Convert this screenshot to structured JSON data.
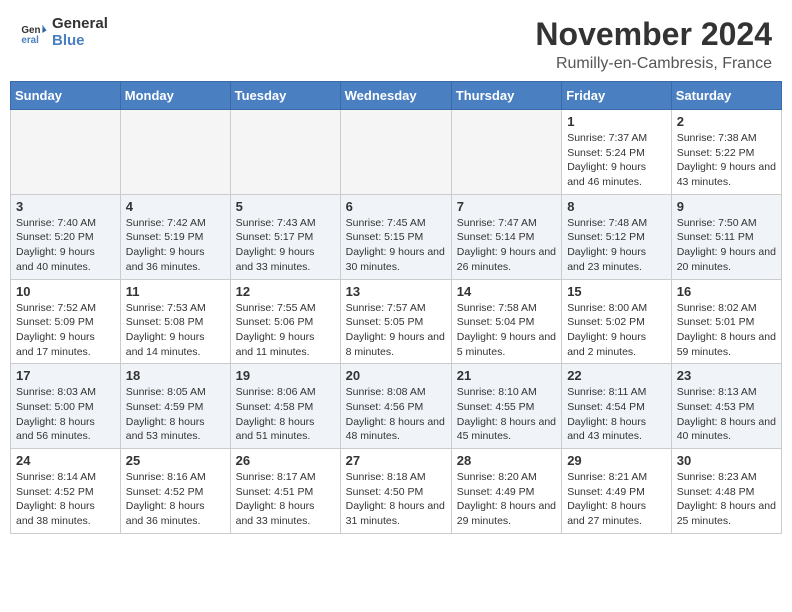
{
  "header": {
    "logo_line1": "General",
    "logo_line2": "Blue",
    "month": "November 2024",
    "location": "Rumilly-en-Cambresis, France"
  },
  "days_of_week": [
    "Sunday",
    "Monday",
    "Tuesday",
    "Wednesday",
    "Thursday",
    "Friday",
    "Saturday"
  ],
  "weeks": [
    [
      {
        "day": "",
        "info": ""
      },
      {
        "day": "",
        "info": ""
      },
      {
        "day": "",
        "info": ""
      },
      {
        "day": "",
        "info": ""
      },
      {
        "day": "",
        "info": ""
      },
      {
        "day": "1",
        "info": "Sunrise: 7:37 AM\nSunset: 5:24 PM\nDaylight: 9 hours and 46 minutes."
      },
      {
        "day": "2",
        "info": "Sunrise: 7:38 AM\nSunset: 5:22 PM\nDaylight: 9 hours and 43 minutes."
      }
    ],
    [
      {
        "day": "3",
        "info": "Sunrise: 7:40 AM\nSunset: 5:20 PM\nDaylight: 9 hours and 40 minutes."
      },
      {
        "day": "4",
        "info": "Sunrise: 7:42 AM\nSunset: 5:19 PM\nDaylight: 9 hours and 36 minutes."
      },
      {
        "day": "5",
        "info": "Sunrise: 7:43 AM\nSunset: 5:17 PM\nDaylight: 9 hours and 33 minutes."
      },
      {
        "day": "6",
        "info": "Sunrise: 7:45 AM\nSunset: 5:15 PM\nDaylight: 9 hours and 30 minutes."
      },
      {
        "day": "7",
        "info": "Sunrise: 7:47 AM\nSunset: 5:14 PM\nDaylight: 9 hours and 26 minutes."
      },
      {
        "day": "8",
        "info": "Sunrise: 7:48 AM\nSunset: 5:12 PM\nDaylight: 9 hours and 23 minutes."
      },
      {
        "day": "9",
        "info": "Sunrise: 7:50 AM\nSunset: 5:11 PM\nDaylight: 9 hours and 20 minutes."
      }
    ],
    [
      {
        "day": "10",
        "info": "Sunrise: 7:52 AM\nSunset: 5:09 PM\nDaylight: 9 hours and 17 minutes."
      },
      {
        "day": "11",
        "info": "Sunrise: 7:53 AM\nSunset: 5:08 PM\nDaylight: 9 hours and 14 minutes."
      },
      {
        "day": "12",
        "info": "Sunrise: 7:55 AM\nSunset: 5:06 PM\nDaylight: 9 hours and 11 minutes."
      },
      {
        "day": "13",
        "info": "Sunrise: 7:57 AM\nSunset: 5:05 PM\nDaylight: 9 hours and 8 minutes."
      },
      {
        "day": "14",
        "info": "Sunrise: 7:58 AM\nSunset: 5:04 PM\nDaylight: 9 hours and 5 minutes."
      },
      {
        "day": "15",
        "info": "Sunrise: 8:00 AM\nSunset: 5:02 PM\nDaylight: 9 hours and 2 minutes."
      },
      {
        "day": "16",
        "info": "Sunrise: 8:02 AM\nSunset: 5:01 PM\nDaylight: 8 hours and 59 minutes."
      }
    ],
    [
      {
        "day": "17",
        "info": "Sunrise: 8:03 AM\nSunset: 5:00 PM\nDaylight: 8 hours and 56 minutes."
      },
      {
        "day": "18",
        "info": "Sunrise: 8:05 AM\nSunset: 4:59 PM\nDaylight: 8 hours and 53 minutes."
      },
      {
        "day": "19",
        "info": "Sunrise: 8:06 AM\nSunset: 4:58 PM\nDaylight: 8 hours and 51 minutes."
      },
      {
        "day": "20",
        "info": "Sunrise: 8:08 AM\nSunset: 4:56 PM\nDaylight: 8 hours and 48 minutes."
      },
      {
        "day": "21",
        "info": "Sunrise: 8:10 AM\nSunset: 4:55 PM\nDaylight: 8 hours and 45 minutes."
      },
      {
        "day": "22",
        "info": "Sunrise: 8:11 AM\nSunset: 4:54 PM\nDaylight: 8 hours and 43 minutes."
      },
      {
        "day": "23",
        "info": "Sunrise: 8:13 AM\nSunset: 4:53 PM\nDaylight: 8 hours and 40 minutes."
      }
    ],
    [
      {
        "day": "24",
        "info": "Sunrise: 8:14 AM\nSunset: 4:52 PM\nDaylight: 8 hours and 38 minutes."
      },
      {
        "day": "25",
        "info": "Sunrise: 8:16 AM\nSunset: 4:52 PM\nDaylight: 8 hours and 36 minutes."
      },
      {
        "day": "26",
        "info": "Sunrise: 8:17 AM\nSunset: 4:51 PM\nDaylight: 8 hours and 33 minutes."
      },
      {
        "day": "27",
        "info": "Sunrise: 8:18 AM\nSunset: 4:50 PM\nDaylight: 8 hours and 31 minutes."
      },
      {
        "day": "28",
        "info": "Sunrise: 8:20 AM\nSunset: 4:49 PM\nDaylight: 8 hours and 29 minutes."
      },
      {
        "day": "29",
        "info": "Sunrise: 8:21 AM\nSunset: 4:49 PM\nDaylight: 8 hours and 27 minutes."
      },
      {
        "day": "30",
        "info": "Sunrise: 8:23 AM\nSunset: 4:48 PM\nDaylight: 8 hours and 25 minutes."
      }
    ]
  ]
}
